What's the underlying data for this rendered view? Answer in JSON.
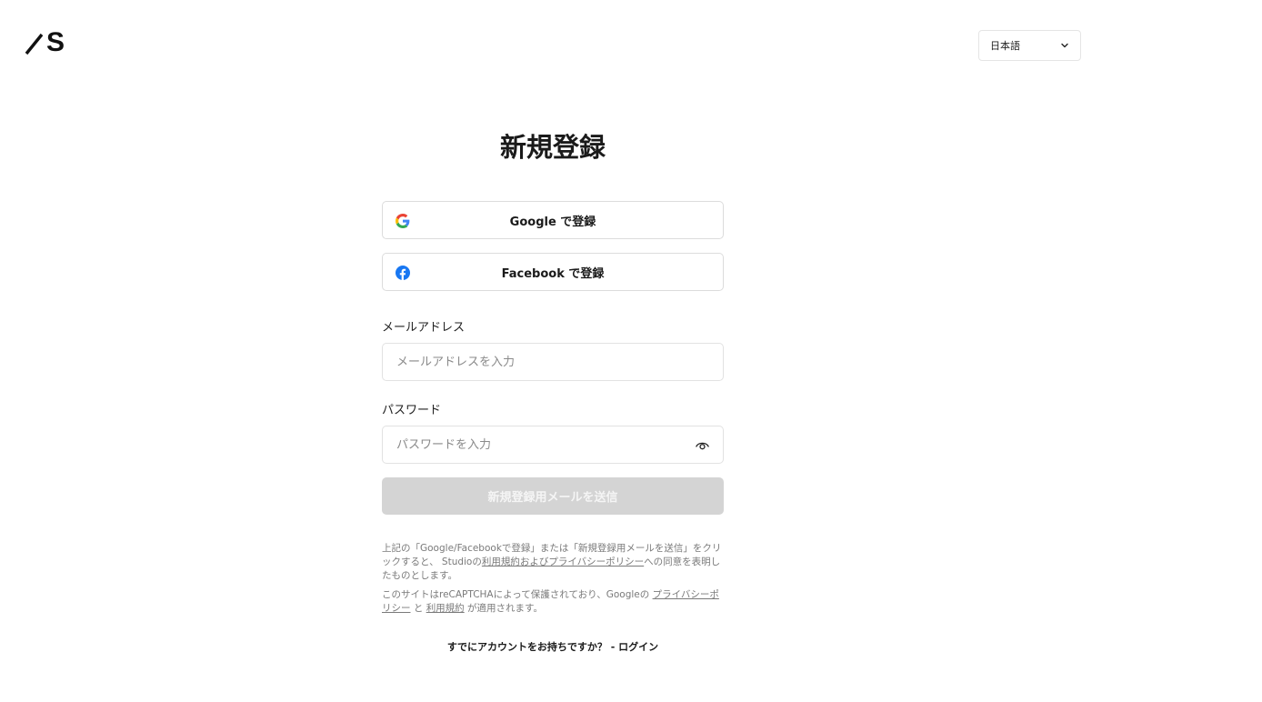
{
  "header": {
    "logo_text": "S",
    "language": {
      "selected": "日本語"
    }
  },
  "signup": {
    "title": "新規登録",
    "google_button": "Google で登録",
    "facebook_button": "Facebook で登録",
    "email_label": "メールアドレス",
    "email_placeholder": "メールアドレスを入力",
    "email_value": "",
    "password_label": "パスワード",
    "password_placeholder": "パスワードを入力",
    "password_value": "",
    "submit_button": "新規登録用メールを送信",
    "submit_enabled": false
  },
  "legal": {
    "terms_prefix": "上記の「Google/Facebookで登録」または「新規登録用メールを送信」をクリックすると、 Studioの",
    "terms_link": "利用規約およびプライバシーポリシー",
    "terms_suffix": "への同意を表明したものとします。",
    "recaptcha_prefix": "このサイトはreCAPTCHAによって保護されており、Googleの ",
    "recaptcha_privacy_link": "プライバシーポリシー",
    "recaptcha_and": " と ",
    "recaptcha_terms_link": "利用規約",
    "recaptcha_suffix": " が適用されます。"
  },
  "footer": {
    "login_link": "すでにアカウントをお持ちですか？ - ログイン"
  },
  "icons": {
    "logo": "studio-logo",
    "language_chevron": "chevron-down-icon",
    "google": "google-icon",
    "facebook": "facebook-icon",
    "password_toggle": "eye-icon"
  },
  "colors": {
    "google_blue": "#4285F4",
    "google_red": "#EA4335",
    "google_yellow": "#FBBC05",
    "google_green": "#34A853",
    "facebook_blue": "#1877F2",
    "submit_disabled_bg": "#d4d4d4"
  }
}
